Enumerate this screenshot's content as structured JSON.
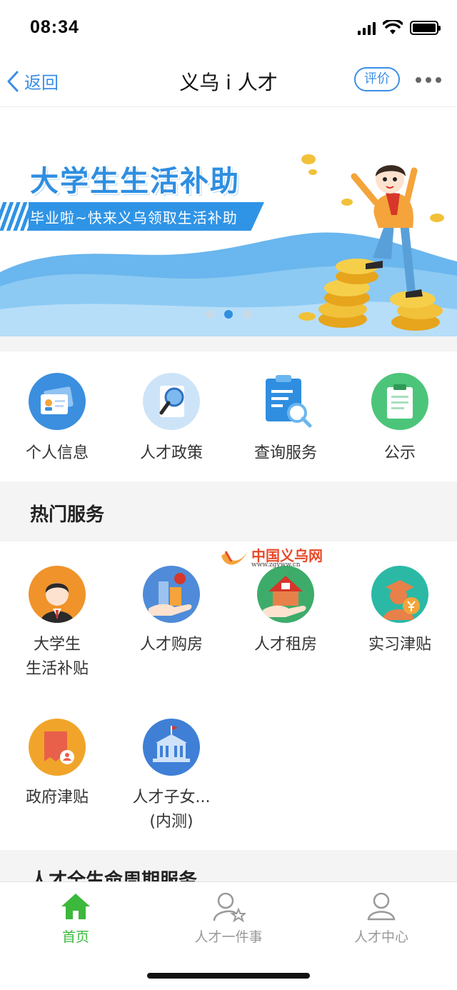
{
  "status_bar": {
    "time": "08:34",
    "icons": [
      "signal-icon",
      "wifi-icon",
      "battery-icon"
    ]
  },
  "nav": {
    "back_label": "返回",
    "title": "义乌 i 人才",
    "rate_label": "评价",
    "more_icon": "more-dots-icon"
  },
  "banner": {
    "title": "大学生生活补助",
    "subtitle": "毕业啦~快来义乌领取生活补助",
    "slides": 3,
    "active_slide": 2
  },
  "quick_menu": [
    {
      "label": "个人信息",
      "icon": "id-card-icon",
      "color": "#3b8fde"
    },
    {
      "label": "人才政策",
      "icon": "magnifier-document-icon",
      "color": "#7bb9ef"
    },
    {
      "label": "查询服务",
      "icon": "clipboard-search-icon",
      "color": "#2f8ee0"
    },
    {
      "label": "公示",
      "icon": "clipboard-icon",
      "color": "#4cc57a"
    }
  ],
  "hot_services": {
    "title": "热门服务",
    "items": [
      {
        "label_line1": "大学生",
        "label_line2": "生活补贴",
        "icon": "graduate-person-icon",
        "color": "#f0932a"
      },
      {
        "label_line1": "人才购房",
        "label_line2": "",
        "icon": "house-purchase-icon",
        "color": "#4f8bd8"
      },
      {
        "label_line1": "人才租房",
        "label_line2": "",
        "icon": "house-rent-icon",
        "color": "#3dac6a"
      },
      {
        "label_line1": "实习津贴",
        "label_line2": "",
        "icon": "intern-allowance-icon",
        "color": "#2bb9a5"
      },
      {
        "label_line1": "政府津贴",
        "label_line2": "",
        "icon": "government-allowance-icon",
        "color": "#f0a52a"
      },
      {
        "label_line1": "人才子女...",
        "label_line2": "(内测)",
        "icon": "school-building-icon",
        "color": "#3f7fd6"
      }
    ]
  },
  "watermark": {
    "text": "中国义乌网",
    "url": "www.zgyww.cn"
  },
  "next_section_title": "人才全生命周期服务",
  "tab_bar": [
    {
      "label": "首页",
      "icon": "home-icon",
      "active": true
    },
    {
      "label": "人才一件事",
      "icon": "person-star-icon",
      "active": false
    },
    {
      "label": "人才中心",
      "icon": "person-icon",
      "active": false
    }
  ],
  "colors": {
    "accent_blue": "#2f8ee0",
    "active_green": "#3cb83c"
  }
}
